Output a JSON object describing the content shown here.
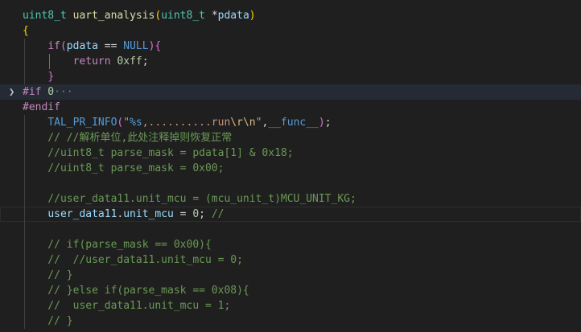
{
  "editor": {
    "lines": [
      [
        [
          "uint8_t",
          "t-type"
        ],
        [
          " ",
          "t-op"
        ],
        [
          "uart_analysis",
          "t-fn"
        ],
        [
          "(",
          "t-br1"
        ],
        [
          "uint8_t",
          "t-type"
        ],
        [
          " *",
          "t-op"
        ],
        [
          "pdata",
          "t-var"
        ],
        [
          ")",
          "t-br1"
        ]
      ],
      [
        [
          "{",
          "t-br1"
        ]
      ],
      [
        [
          "    ",
          "t-op"
        ],
        [
          "if",
          "t-kw"
        ],
        [
          "(",
          "t-br2"
        ],
        [
          "pdata",
          "t-var"
        ],
        [
          " == ",
          "t-op"
        ],
        [
          "NULL",
          "t-mac"
        ],
        [
          ")",
          "t-br2"
        ],
        [
          "{",
          "t-br2"
        ]
      ],
      [
        [
          "        ",
          "t-op"
        ],
        [
          "return",
          "t-kw"
        ],
        [
          " ",
          "t-op"
        ],
        [
          "0xff",
          "t-num"
        ],
        [
          ";",
          "t-op"
        ]
      ],
      [
        [
          "    ",
          "t-op"
        ],
        [
          "}",
          "t-br2"
        ]
      ],
      [
        [
          "#if",
          "t-pre"
        ],
        [
          " 0",
          "t-num"
        ],
        [
          "···",
          "t-dots"
        ]
      ],
      [
        [
          "#endif",
          "t-pre"
        ]
      ],
      [
        [
          "    ",
          "t-op"
        ],
        [
          "TAL_PR_INFO",
          "t-mac"
        ],
        [
          "(",
          "t-br2"
        ],
        [
          "\"",
          "t-str"
        ],
        [
          "%s",
          "t-mac"
        ],
        [
          ",..........run",
          "t-str"
        ],
        [
          "\\r\\n",
          "t-esc"
        ],
        [
          "\"",
          "t-str"
        ],
        [
          ",",
          "t-op"
        ],
        [
          "__func__",
          "t-mac"
        ],
        [
          ")",
          "t-br2"
        ],
        [
          ";",
          "t-op"
        ]
      ],
      [
        [
          "    // //解析单位,此处注释掉则恢复正常",
          "t-com"
        ]
      ],
      [
        [
          "    //uint8_t parse_mask = pdata[1] & 0x18;",
          "t-com"
        ]
      ],
      [
        [
          "    //uint8_t parse_mask = 0x00;",
          "t-com"
        ]
      ],
      [
        [
          "",
          "t-op"
        ]
      ],
      [
        [
          "    //user_data11.unit_mcu = (mcu_unit_t)MCU_UNIT_KG;",
          "t-com"
        ]
      ],
      [
        [
          "    ",
          "t-op"
        ],
        [
          "user_data11",
          "t-var"
        ],
        [
          ".",
          "t-op"
        ],
        [
          "unit_mcu",
          "t-var"
        ],
        [
          " = ",
          "t-op"
        ],
        [
          "0",
          "t-num"
        ],
        [
          "; ",
          "t-op"
        ],
        [
          "//",
          "t-com"
        ]
      ],
      [
        [
          "",
          "t-op"
        ]
      ],
      [
        [
          "    // if(parse_mask == 0x00){",
          "t-com"
        ]
      ],
      [
        [
          "    //  //user_data11.unit_mcu = 0;",
          "t-com"
        ]
      ],
      [
        [
          "    // }",
          "t-com"
        ]
      ],
      [
        [
          "    // }else if(parse_mask == 0x08){",
          "t-com"
        ]
      ],
      [
        [
          "    //  user_data11.unit_mcu = 1;",
          "t-com"
        ]
      ],
      [
        [
          "    // }",
          "t-com"
        ]
      ]
    ],
    "folded_line": 5,
    "current_line": 13,
    "fold_icon": "chevron-right-icon"
  }
}
